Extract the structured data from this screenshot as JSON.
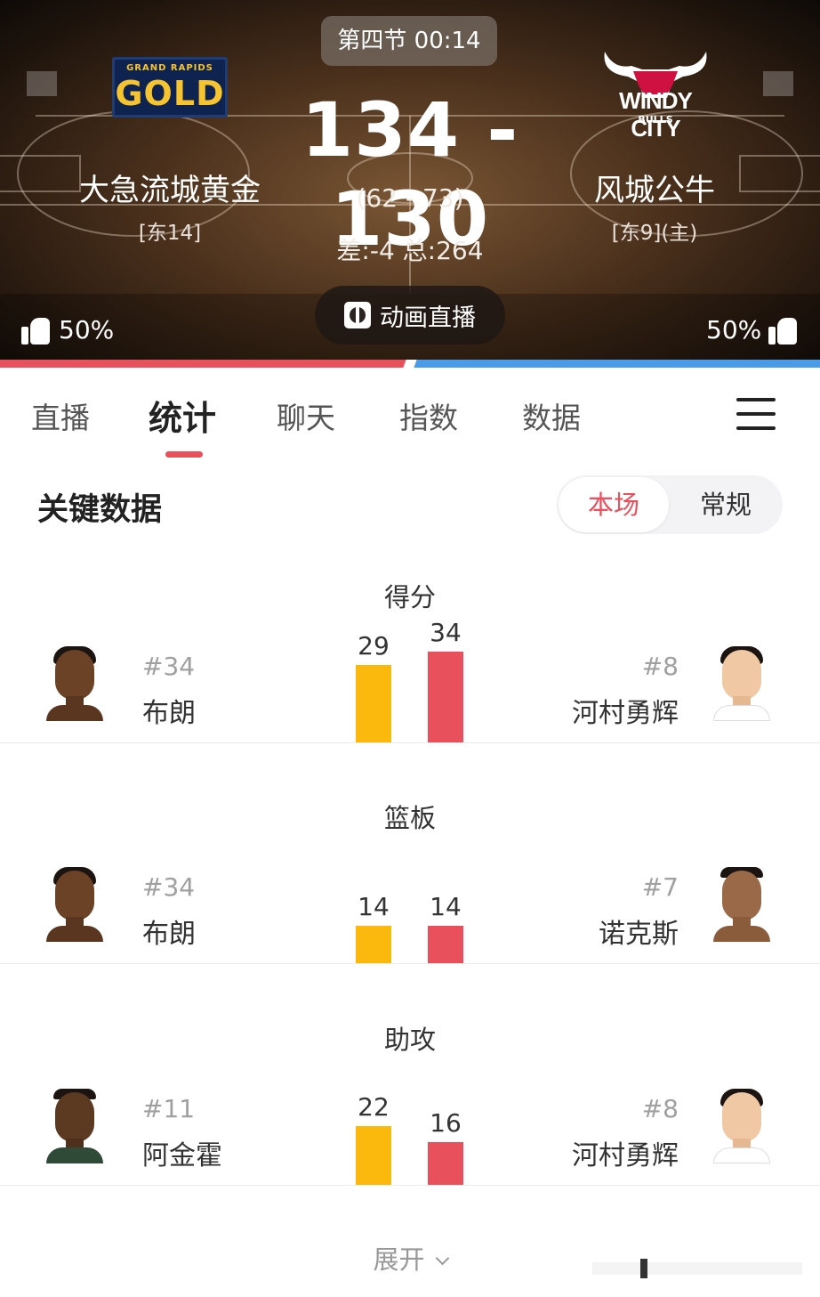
{
  "game": {
    "period_clock": "第四节 00:14",
    "score": "134 - 130",
    "half_score": "(62 - 73)",
    "diff_total": "差:-4 总:264",
    "live_button": "动画直播"
  },
  "home_team": {
    "name": "大急流城黄金",
    "rank": "[东14]",
    "logo_text_top": "GRAND RAPIDS",
    "logo_text_main": "GOLD",
    "vote": "50%",
    "bar_color": "#e8505b"
  },
  "away_team": {
    "name": "风城公牛",
    "rank": "[东9](主)",
    "logo_text_main": "WINDY CITY",
    "logo_text_sub": "BULLS",
    "vote": "50%",
    "bar_color": "#4a9be8"
  },
  "tabs": [
    {
      "label": "直播",
      "active": false
    },
    {
      "label": "统计",
      "active": true
    },
    {
      "label": "聊天",
      "active": false
    },
    {
      "label": "指数",
      "active": false
    },
    {
      "label": "数据",
      "active": false
    }
  ],
  "key_stats": {
    "title": "关键数据",
    "toggle_on": "本场",
    "toggle_off": "常规",
    "home_color": "#fbb80d",
    "away_color": "#e8505b",
    "items": [
      {
        "label": "得分",
        "home": {
          "number": "#34",
          "name": "布朗",
          "value": 29
        },
        "away": {
          "number": "#8",
          "name": "河村勇辉",
          "value": 34
        }
      },
      {
        "label": "篮板",
        "home": {
          "number": "#34",
          "name": "布朗",
          "value": 14
        },
        "away": {
          "number": "#7",
          "name": "诺克斯",
          "value": 14
        }
      },
      {
        "label": "助攻",
        "home": {
          "number": "#11",
          "name": "阿金霍",
          "value": 22
        },
        "away": {
          "number": "#8",
          "name": "河村勇辉",
          "value": 16
        }
      }
    ],
    "expand_label": "展开"
  }
}
